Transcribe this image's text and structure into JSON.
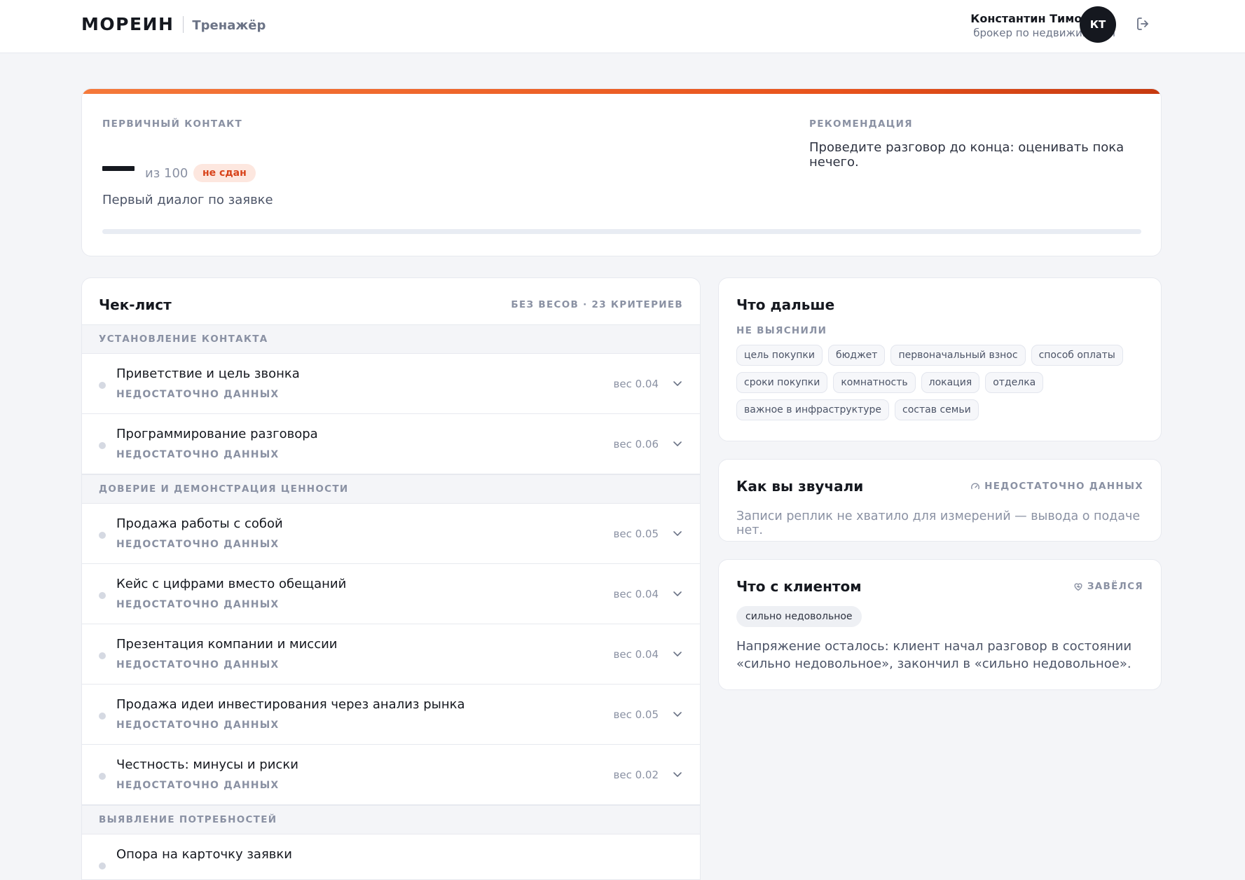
{
  "header": {
    "brand": "МОРЕИН",
    "product": "Тренажёр",
    "user_name": "Константин Тимофеев",
    "user_role": "брокер по недвижимости",
    "avatar_initials": "КТ"
  },
  "summary": {
    "label": "ПЕРВИЧНЫЙ КОНТАКТ",
    "score_of": "из 100",
    "badge": "не сдан",
    "description": "Первый диалог по заявке",
    "progress": 0,
    "recommendation_label": "РЕКОМЕНДАЦИЯ",
    "recommendation_text": "Проведите разговор до конца: оценивать пока нечего."
  },
  "checklist": {
    "title": "Чек-лист",
    "meta": "БЕЗ ВЕСОВ · 23 КРИТЕРИЕВ",
    "sections": [
      {
        "title": "УСТАНОВЛЕНИЕ КОНТАКТА",
        "items": [
          {
            "title": "Приветствие и цель звонка",
            "status": "НЕДОСТАТОЧНО ДАННЫХ",
            "weight": "вес 0.04"
          },
          {
            "title": "Программирование разговора",
            "status": "НЕДОСТАТОЧНО ДАННЫХ",
            "weight": "вес 0.06"
          }
        ]
      },
      {
        "title": "ДОВЕРИЕ И ДЕМОНСТРАЦИЯ ЦЕННОСТИ",
        "items": [
          {
            "title": "Продажа работы с собой",
            "status": "НЕДОСТАТОЧНО ДАННЫХ",
            "weight": "вес 0.05"
          },
          {
            "title": "Кейс с цифрами вместо обещаний",
            "status": "НЕДОСТАТОЧНО ДАННЫХ",
            "weight": "вес 0.04"
          },
          {
            "title": "Презентация компании и миссии",
            "status": "НЕДОСТАТОЧНО ДАННЫХ",
            "weight": "вес 0.04"
          },
          {
            "title": "Продажа идеи инвестирования через анализ рынка",
            "status": "НЕДОСТАТОЧНО ДАННЫХ",
            "weight": "вес 0.05"
          },
          {
            "title": "Честность: минусы и риски",
            "status": "НЕДОСТАТОЧНО ДАННЫХ",
            "weight": "вес 0.02"
          }
        ]
      },
      {
        "title": "ВЫЯВЛЕНИЕ ПОТРЕБНОСТЕЙ",
        "items": [
          {
            "title": "Опора на карточку заявки",
            "status": "",
            "weight": ""
          }
        ]
      }
    ]
  },
  "next_steps": {
    "title": "Что дальше",
    "subtitle": "НЕ ВЫЯСНИЛИ",
    "tags": [
      "цель покупки",
      "бюджет",
      "первоначальный взнос",
      "способ оплаты",
      "сроки покупки",
      "комнатность",
      "локация",
      "отделка",
      "важное в инфраструктуре",
      "состав семьи"
    ]
  },
  "sound": {
    "title": "Как вы звучали",
    "status": "НЕДОСТАТОЧНО ДАННЫХ",
    "text": "Записи реплик не хватило для измерений — вывода о подаче нет."
  },
  "client": {
    "title": "Что с клиентом",
    "status": "ЗАВЁЛСЯ",
    "chip": "сильно недовольное",
    "text": "Напряжение осталось: клиент начал разговор в состоянии «сильно недовольное», закончил в «сильно недовольное»."
  }
}
